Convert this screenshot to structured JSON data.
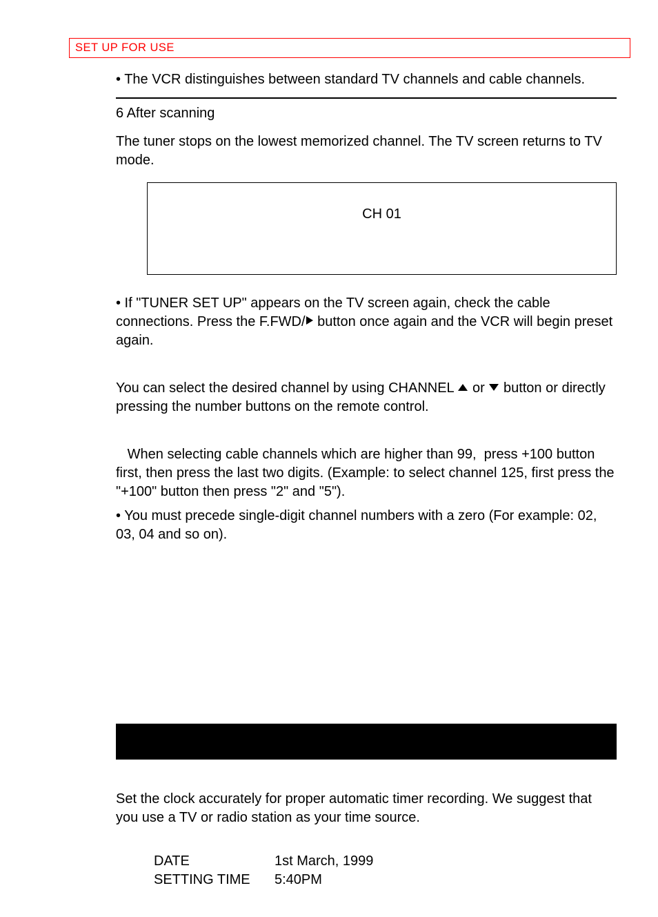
{
  "header": "SET UP  FOR USE",
  "bullet1": "• The VCR distinguishes between standard TV channels and cable channels.",
  "step6": "6  After scanning",
  "tuner_stop": "The tuner stops on the lowest memorized channel. The TV screen returns to TV mode.",
  "ch_display": "CH 01",
  "tuner_setup_pre": "• If \"TUNER SET UP\" appears on the TV screen again, check the cable connections. Press the F.FWD/",
  "tuner_setup_post": " button once again and the VCR will begin preset again.",
  "channel_select_pre": "You can select the desired channel by using CHANNEL ",
  "channel_select_mid": " or ",
  "channel_select_post": " button or directly pressing the number buttons on the remote control.",
  "cable_note": "   When selecting cable channels which are higher than 99,  press +100 button first, then press the last two digits. (Example: to select channel 125, first press the \"+100\" button then press \"2\" and \"5\").",
  "single_digit": "• You must precede single-digit channel numbers with a zero (For example: 02, 03, 04 and so on).",
  "clock_text": "Set the clock accurately for proper automatic timer recording. We suggest that you use a TV or radio station as your time source.",
  "example_date_label": "DATE",
  "example_date_value": "1st March, 1999",
  "example_time_label": "SETTING TIME",
  "example_time_value": "5:40PM"
}
